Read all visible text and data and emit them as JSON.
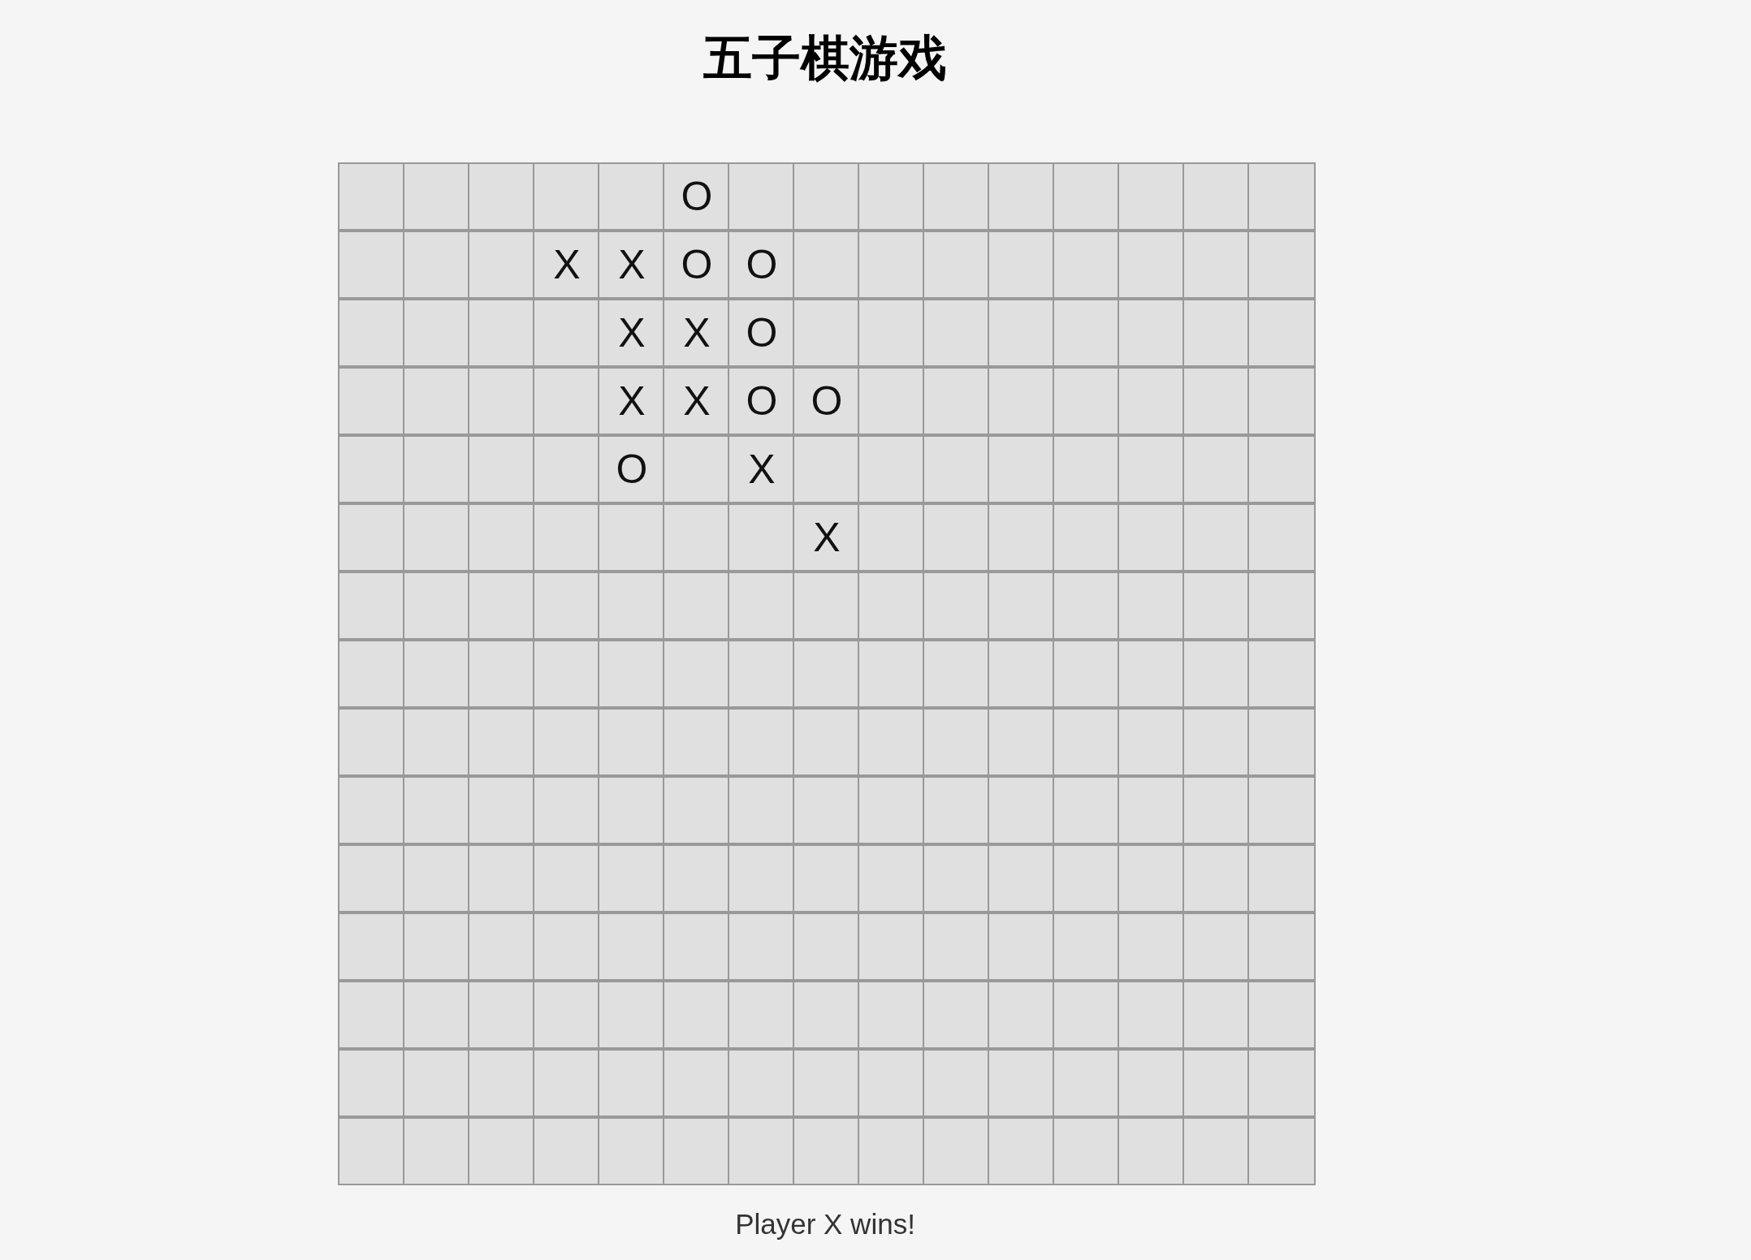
{
  "title": "五子棋游戏",
  "board": {
    "rows": [
      {
        "cells": [
          {},
          {},
          {},
          {},
          {},
          {
            "mark": "O"
          },
          {},
          {},
          {},
          {},
          {},
          {},
          {},
          {},
          {}
        ]
      },
      {
        "cells": [
          {},
          {},
          {},
          {
            "mark": "X"
          },
          {
            "mark": "X"
          },
          {
            "mark": "O"
          },
          {
            "mark": "O"
          },
          {},
          {},
          {},
          {},
          {},
          {},
          {},
          {}
        ]
      },
      {
        "cells": [
          {},
          {},
          {},
          {},
          {
            "mark": "X"
          },
          {
            "mark": "X"
          },
          {
            "mark": "O"
          },
          {},
          {},
          {},
          {},
          {},
          {},
          {},
          {}
        ]
      },
      {
        "cells": [
          {},
          {},
          {},
          {},
          {
            "mark": "X"
          },
          {
            "mark": "X"
          },
          {
            "mark": "O"
          },
          {
            "mark": "O"
          },
          {},
          {},
          {},
          {},
          {},
          {},
          {}
        ]
      },
      {
        "cells": [
          {},
          {},
          {},
          {},
          {
            "mark": "O"
          },
          {},
          {
            "mark": "X"
          },
          {},
          {},
          {},
          {},
          {},
          {},
          {},
          {}
        ]
      },
      {
        "cells": [
          {},
          {},
          {},
          {},
          {},
          {},
          {},
          {
            "mark": "X"
          },
          {},
          {},
          {},
          {},
          {},
          {},
          {}
        ]
      },
      {
        "cells": [
          {},
          {},
          {},
          {},
          {},
          {},
          {},
          {},
          {},
          {},
          {},
          {},
          {},
          {},
          {}
        ]
      },
      {
        "cells": [
          {},
          {},
          {},
          {},
          {},
          {},
          {},
          {},
          {},
          {},
          {},
          {},
          {},
          {},
          {}
        ]
      },
      {
        "cells": [
          {},
          {},
          {},
          {},
          {},
          {},
          {},
          {},
          {},
          {},
          {},
          {},
          {},
          {},
          {}
        ]
      },
      {
        "cells": [
          {},
          {},
          {},
          {},
          {},
          {},
          {},
          {},
          {},
          {},
          {},
          {},
          {},
          {},
          {}
        ]
      },
      {
        "cells": [
          {},
          {},
          {},
          {},
          {},
          {},
          {},
          {},
          {},
          {},
          {},
          {},
          {},
          {},
          {}
        ]
      },
      {
        "cells": [
          {},
          {},
          {},
          {},
          {},
          {},
          {},
          {},
          {},
          {},
          {},
          {},
          {},
          {},
          {}
        ]
      },
      {
        "cells": [
          {},
          {},
          {},
          {},
          {},
          {},
          {},
          {},
          {},
          {},
          {},
          {},
          {},
          {},
          {}
        ]
      },
      {
        "cells": [
          {},
          {},
          {},
          {},
          {},
          {},
          {},
          {},
          {},
          {},
          {},
          {},
          {},
          {},
          {}
        ]
      },
      {
        "cells": [
          {},
          {},
          {},
          {},
          {},
          {},
          {},
          {},
          {},
          {},
          {},
          {},
          {},
          {},
          {}
        ]
      }
    ]
  },
  "status": "Player X wins!"
}
